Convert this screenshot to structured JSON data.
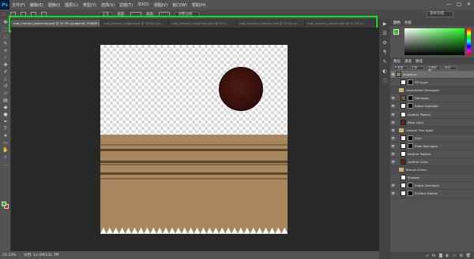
{
  "app": {
    "logo": "Ps",
    "workspace": "基本功能"
  },
  "menu": [
    "文件(F)",
    "编辑(E)",
    "图像(I)",
    "图层(L)",
    "类型(Y)",
    "选择(S)",
    "滤镜(T)",
    "3D(D)",
    "视图(V)",
    "窗口(W)",
    "帮助(H)"
  ],
  "window_controls": [
    "—",
    "□",
    "✕"
  ],
  "options": {
    "style": "正常",
    "width_label": "宽度:",
    "height_label": "高度:",
    "refine": "调整边缘..."
  },
  "tabs": [
    {
      "label": "mat_checker_basecolor.psd @ 33.3% (snapshot, RGB/8*)",
      "active": true
    },
    {
      "label": "mat_checker_height.psd @ 33.3% (le...",
      "active": false
    },
    {
      "label": "mat_checker_roughness.psd @ 33.3...",
      "active": false
    },
    {
      "label": "mat_checker_metallic.psd @ 33.3% (s...",
      "active": false
    },
    {
      "label": "mat_checker_normal.psd @ 33.3% (s...",
      "active": false
    }
  ],
  "status": {
    "zoom": "33.33%",
    "doc": "文档: 12.0M/131.7M"
  },
  "panels": {
    "color_tabs": [
      "颜色",
      "色板"
    ],
    "layers_tabs": [
      "图层",
      "通道",
      "路径"
    ],
    "filter_kind": "P 类型",
    "blend_mode": "正常",
    "opacity": "不透明度:",
    "fill": "填充:"
  },
  "layers": [
    {
      "name": "snapshot",
      "type": "layer",
      "selected": true,
      "thumb": "#8f7658",
      "mask": false
    },
    {
      "name": "FB Layer",
      "type": "layer",
      "selected": false,
      "thumb": "#ffffff",
      "mask": true
    },
    {
      "name": "Leatherette Damaged",
      "type": "group",
      "selected": false
    },
    {
      "name": "Damages",
      "type": "layer",
      "selected": false,
      "thumb": "#7a5a3c",
      "mask": true
    },
    {
      "name": "Edges Highlight",
      "type": "layer",
      "selected": false,
      "thumb": "#ffffff",
      "mask": true
    },
    {
      "name": "Leather Pattern",
      "type": "layer",
      "selected": false,
      "thumb": "#ffffff",
      "mask": false
    },
    {
      "name": "Base Color",
      "type": "layer",
      "selected": false,
      "thumb": "#6a1e16",
      "mask": false
    },
    {
      "name": "Leather Fine Aged",
      "type": "group",
      "selected": false
    },
    {
      "name": "Dust",
      "type": "layer",
      "selected": false,
      "thumb": "#ffffff",
      "mask": true
    },
    {
      "name": "Edge Damages",
      "type": "layer",
      "selected": false,
      "thumb": "#ffffff",
      "mask": true
    },
    {
      "name": "Leather Pattern",
      "type": "layer",
      "selected": false,
      "thumb": "#ffffff",
      "mask": false
    },
    {
      "name": "Leather Color",
      "type": "layer",
      "selected": false,
      "thumb": "#6a1e16",
      "mask": false
    },
    {
      "name": "Bronze Armor",
      "type": "group",
      "selected": false
    },
    {
      "name": "Shadow",
      "type": "layer",
      "selected": false,
      "thumb": "#ffffff",
      "mask": false
    },
    {
      "name": "Edges Damages",
      "type": "layer",
      "selected": false,
      "thumb": "#ffffff",
      "mask": true
    },
    {
      "name": "Surface Details",
      "type": "layer",
      "selected": false,
      "thumb": "#ffffff",
      "mask": true
    }
  ],
  "colors": {
    "foreground": "#22c322",
    "background": "#c81414",
    "highlight": "#1fdc1f"
  }
}
